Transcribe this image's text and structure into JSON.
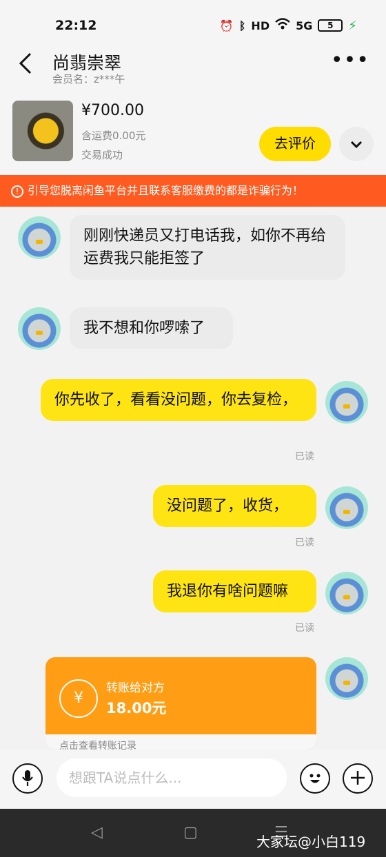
{
  "status_bar": {
    "time": "22:12",
    "network": "5G",
    "hd": "HD",
    "battery": "5"
  },
  "header": {
    "title": "尚翡崇翠",
    "member": "会员名：z***午"
  },
  "product": {
    "price": "¥700.00",
    "shipping": "含运费0.00元",
    "status": "交易成功",
    "rate_label": "去评价"
  },
  "warning": "引导您脱离闲鱼平台并且联系客服缴费的都是诈骗行为！",
  "messages": [
    {
      "from": "other",
      "text": "刚刚快递员又打电话我，如你不再给运费我只能拒签了"
    },
    {
      "from": "other",
      "text": "我不想和你啰嗦了"
    },
    {
      "from": "me",
      "text": "你先收了，看看没问题，你去复检，",
      "status": "已读"
    },
    {
      "from": "me",
      "text": "没问题了，收货，",
      "status": "已读"
    },
    {
      "from": "me",
      "text": "我退你有啥问题嘛",
      "status": "已读"
    }
  ],
  "transfer": {
    "label": "转账给对方",
    "amount": "18.00元",
    "footer": "点击查看转账记录"
  },
  "input": {
    "placeholder": "想跟TA说点什么..."
  },
  "watermark": "大家坛@小白119",
  "colors": {
    "accent_yellow": "#ffe413",
    "warning_orange": "#ff5a1f",
    "transfer_orange": "#ff9d14"
  }
}
